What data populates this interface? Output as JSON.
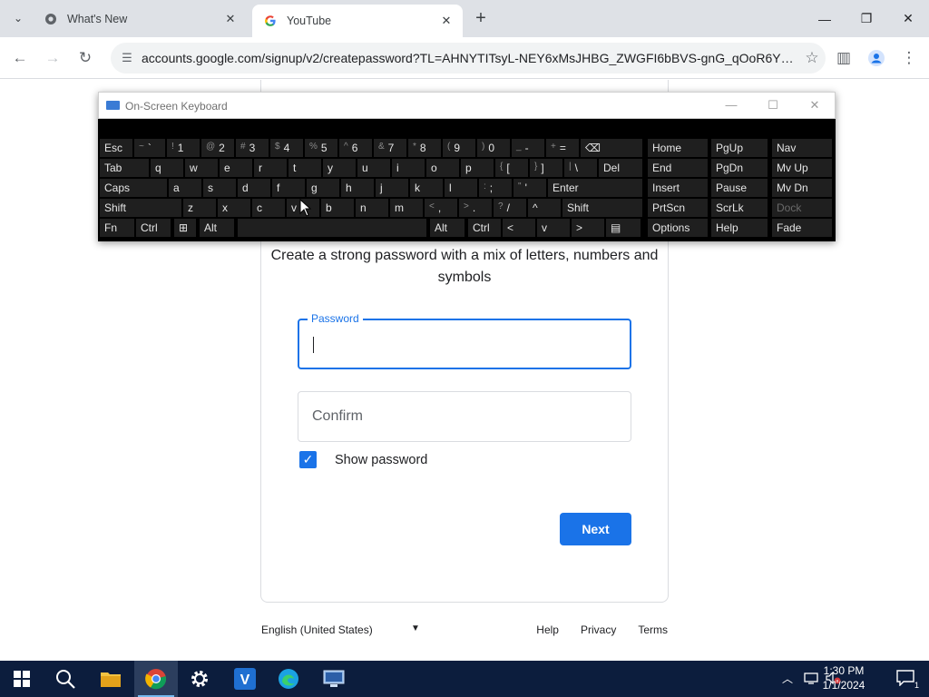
{
  "browser": {
    "tabs": [
      {
        "title": "What's New",
        "active": false
      },
      {
        "title": "YouTube",
        "active": true
      }
    ],
    "url": "accounts.google.com/signup/v2/createpassword?TL=AHNYTITsyL-NEY6xMsJHBG_ZWGFI6bBVS-gnG_qOoR6YM9..."
  },
  "page": {
    "subtitle": "Create a strong password with a mix of letters, numbers and symbols",
    "password_label": "Password",
    "password_value": "",
    "confirm_placeholder": "Confirm",
    "show_password_label": "Show password",
    "show_password_checked": true,
    "next_label": "Next",
    "footer": {
      "language": "English (United States)",
      "links": [
        "Help",
        "Privacy",
        "Terms"
      ]
    }
  },
  "osk": {
    "title": "On-Screen Keyboard",
    "rows": [
      [
        {
          "l": "Esc"
        },
        {
          "s": "~",
          "l": "`"
        },
        {
          "s": "!",
          "l": "1"
        },
        {
          "s": "@",
          "l": "2"
        },
        {
          "s": "#",
          "l": "3"
        },
        {
          "s": "$",
          "l": "4"
        },
        {
          "s": "%",
          "l": "5"
        },
        {
          "s": "^",
          "l": "6"
        },
        {
          "s": "&",
          "l": "7"
        },
        {
          "s": "*",
          "l": "8"
        },
        {
          "s": "(",
          "l": "9"
        },
        {
          "s": ")",
          "l": "0"
        },
        {
          "s": "_",
          "l": "-"
        },
        {
          "s": "+",
          "l": "="
        },
        {
          "l": "⌫"
        },
        {
          "l": "Home"
        },
        {
          "l": "PgUp"
        },
        {
          "l": "Nav"
        }
      ],
      [
        {
          "l": "Tab"
        },
        {
          "l": "q"
        },
        {
          "l": "w"
        },
        {
          "l": "e"
        },
        {
          "l": "r"
        },
        {
          "l": "t"
        },
        {
          "l": "y"
        },
        {
          "l": "u"
        },
        {
          "l": "i"
        },
        {
          "l": "o"
        },
        {
          "l": "p"
        },
        {
          "s": "{",
          "l": "["
        },
        {
          "s": "}",
          "l": "]"
        },
        {
          "s": "|",
          "l": "\\"
        },
        {
          "l": "Del"
        },
        {
          "l": "End"
        },
        {
          "l": "PgDn"
        },
        {
          "l": "Mv Up"
        }
      ],
      [
        {
          "l": "Caps"
        },
        {
          "l": "a"
        },
        {
          "l": "s"
        },
        {
          "l": "d"
        },
        {
          "l": "f"
        },
        {
          "l": "g"
        },
        {
          "l": "h"
        },
        {
          "l": "j"
        },
        {
          "l": "k"
        },
        {
          "l": "l"
        },
        {
          "s": ":",
          "l": ";"
        },
        {
          "s": "\"",
          "l": "'"
        },
        {
          "l": "Enter"
        },
        {
          "l": "Insert"
        },
        {
          "l": "Pause"
        },
        {
          "l": "Mv Dn"
        }
      ],
      [
        {
          "l": "Shift"
        },
        {
          "l": "z"
        },
        {
          "l": "x"
        },
        {
          "l": "c"
        },
        {
          "l": "v"
        },
        {
          "l": "b"
        },
        {
          "l": "n"
        },
        {
          "l": "m"
        },
        {
          "s": "<",
          "l": ","
        },
        {
          "s": ">",
          "l": "."
        },
        {
          "s": "?",
          "l": "/"
        },
        {
          "l": "^"
        },
        {
          "l": "Shift"
        },
        {
          "l": "PrtScn"
        },
        {
          "l": "ScrLk"
        },
        {
          "l": "Dock"
        }
      ],
      [
        {
          "l": "Fn"
        },
        {
          "l": "Ctrl"
        },
        {
          "l": "⊞"
        },
        {
          "l": "Alt"
        },
        {
          "l": ""
        },
        {
          "l": "Alt"
        },
        {
          "l": "Ctrl"
        },
        {
          "l": "<"
        },
        {
          "l": "v"
        },
        {
          "l": ">"
        },
        {
          "l": "▤"
        },
        {
          "l": "Options"
        },
        {
          "l": "Help"
        },
        {
          "l": "Fade"
        }
      ]
    ]
  },
  "taskbar": {
    "apps": [
      "start-icon",
      "search-icon",
      "file-explorer-icon",
      "chrome-icon",
      "settings-icon",
      "v-app-icon",
      "edge-icon",
      "monitor-app-icon"
    ],
    "time": "1:30 PM",
    "date": "1/1/2024",
    "notification_count": "1"
  }
}
